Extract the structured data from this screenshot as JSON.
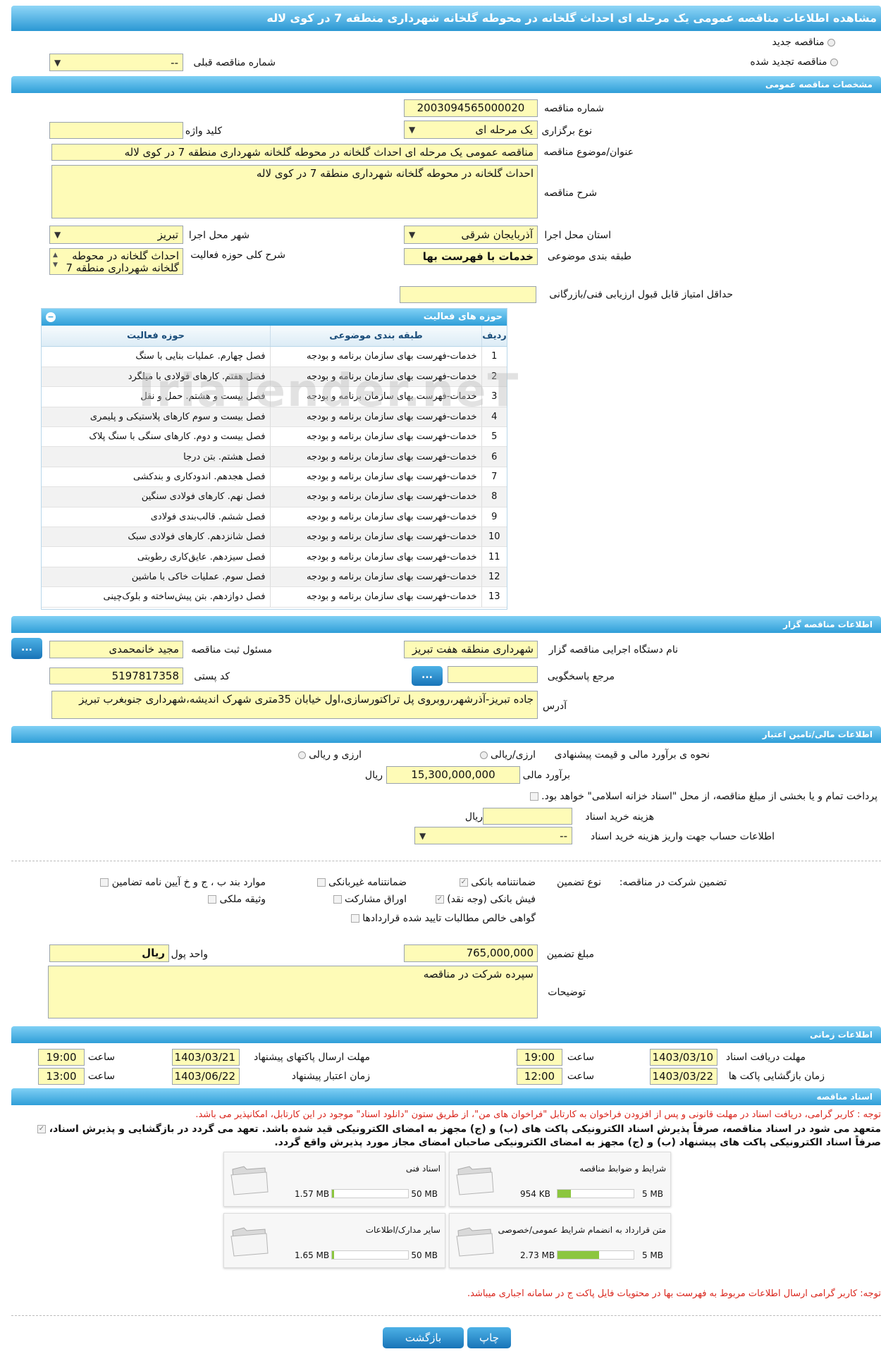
{
  "page_title": "مشاهده اطلاعات مناقصه عمومی یک مرحله ای احداث گلخانه در محوطه گلخانه شهرداری منطقه 7 در کوی لاله",
  "top": {
    "radio_new": "مناقصه جدید",
    "radio_renewed": "مناقصه تجدید شده",
    "prev_number_label": "شماره مناقصه قبلی",
    "prev_number_value": "--"
  },
  "general": {
    "section_title": "مشخصات مناقصه عمومی",
    "number_label": "شماره مناقصه",
    "number_value": "2003094565000020",
    "type_label": "نوع برگزاری",
    "type_value": "یک مرحله ای",
    "keyword_label": "کلید واژه",
    "keyword_value": "",
    "subject_label": "عنوان/موضوع مناقصه",
    "subject_value": "مناقصه عمومی یک مرحله ای احداث گلخانه در محوطه گلخانه شهرداری منطقه 7 در کوی لاله",
    "desc_label": "شرح مناقصه",
    "desc_value": "احداث گلخانه در محوطه گلخانه شهرداری منطقه 7 در کوی لاله",
    "province_label": "استان محل اجرا",
    "province_value": "آذربایجان شرقی",
    "city_label": "شهر محل اجرا",
    "city_value": "تبریز",
    "category_label": "طبقه بندی موضوعی",
    "category_value": "خدمات با فهرست بها",
    "activity_desc_label": "شرح کلی حوزه فعالیت",
    "activity_desc_value": "احداث گلخانه در محوطه گلخانه شهرداری منطقه 7",
    "min_score_label": "حداقل امتیاز قابل قبول ارزیابی فنی/بازرگانی",
    "min_score_value": ""
  },
  "activities": {
    "title": "حوزه های فعالیت",
    "col_row": "ردیف",
    "col_category": "طبقه بندی موضوعی",
    "col_activity": "حوزه فعالیت",
    "rows": [
      {
        "n": "1",
        "cat": "خدمات-فهرست بهای سازمان برنامه و بودجه",
        "act": "فصل چهارم. عملیات بنایی با سنگ"
      },
      {
        "n": "2",
        "cat": "خدمات-فهرست بهای سازمان برنامه و بودجه",
        "act": "فصل هفتم. کارهای فولادی با میلگرد"
      },
      {
        "n": "3",
        "cat": "خدمات-فهرست بهای سازمان برنامه و بودجه",
        "act": "فصل بیست و هشتم. حمل و نقل"
      },
      {
        "n": "4",
        "cat": "خدمات-فهرست بهای سازمان برنامه و بودجه",
        "act": "فصل بیست و سوم کارهای پلاستیکی و پلیمری"
      },
      {
        "n": "5",
        "cat": "خدمات-فهرست بهای سازمان برنامه و بودجه",
        "act": "فصل بیست و دوم. کارهای سنگی با سنگ پلاک"
      },
      {
        "n": "6",
        "cat": "خدمات-فهرست بهای سازمان برنامه و بودجه",
        "act": "فصل هشتم. بتن درجا"
      },
      {
        "n": "7",
        "cat": "خدمات-فهرست بهای سازمان برنامه و بودجه",
        "act": "فصل هجدهم. اندودکاری و بندکشی"
      },
      {
        "n": "8",
        "cat": "خدمات-فهرست بهای سازمان برنامه و بودجه",
        "act": "فصل نهم. کارهای فولادی سنگین"
      },
      {
        "n": "9",
        "cat": "خدمات-فهرست بهای سازمان برنامه و بودجه",
        "act": "فصل ششم. قالب‌بندی فولادی"
      },
      {
        "n": "10",
        "cat": "خدمات-فهرست بهای سازمان برنامه و بودجه",
        "act": "فصل شانزدهم. کارهای فولادی سبک"
      },
      {
        "n": "11",
        "cat": "خدمات-فهرست بهای سازمان برنامه و بودجه",
        "act": "فصل سیزدهم. عایق‌کاری رطوبتی"
      },
      {
        "n": "12",
        "cat": "خدمات-فهرست بهای سازمان برنامه و بودجه",
        "act": "فصل سوم. عملیات خاکی با ماشین"
      },
      {
        "n": "13",
        "cat": "خدمات-فهرست بهای سازمان برنامه و بودجه",
        "act": "فصل دوازدهم. بتن پیش‌ساخته و بلوک‌چینی"
      }
    ]
  },
  "organizer": {
    "section_title": "اطلاعات مناقصه گزار",
    "org_label": "نام دستگاه اجرایی مناقصه گزار",
    "org_value": "شهرداری منطقه هفت تبریز",
    "resp_label": "مسئول ثبت مناقصه",
    "resp_value": "مجید خانمحمدی",
    "ref_label": "مرجع پاسخگویی",
    "ref_value": "",
    "postal_label": "کد پستی",
    "postal_value": "5197817358",
    "address_label": "آدرس",
    "address_value": "جاده تبریز-آذرشهر،روبروی پل تراکتورسازی،اول خیابان 35متری شهرک اندیشه،شهرداری جنوبغرب تبریز",
    "dots": "..."
  },
  "finance": {
    "section_title": "اطلاعات مالی/تامین اعتبار",
    "method_label": "نحوه ی برآورد مالی و قیمت پیشنهادی",
    "opt1": "ارزی/ریالی",
    "opt2": "ارزی و ریالی",
    "estimate_label": "برآورد مالی",
    "estimate_value": "15,300,000,000",
    "rial": "ریال",
    "treasury_text": "پرداخت تمام و یا بخشی از مبلغ مناقصه، از محل \"اسناد خزانه اسلامی\" خواهد بود.",
    "doc_cost_label": "هزینه خرید اسناد",
    "doc_cost_value": "",
    "account_label": "اطلاعات حساب جهت واریز هزینه خرید اسناد",
    "account_value": "--"
  },
  "guarantee": {
    "label": "تضمین شرکت در مناقصه:",
    "type_label": "نوع تضمین",
    "opt_bank": "ضمانتنامه بانکی",
    "opt_nonbank": "ضمانتنامه غیربانکی",
    "opt_b": "موارد بند ب ، ج و خ آیین نامه تضامین",
    "opt_cash": "فیش بانکی (وجه نقد)",
    "opt_bonds": "اوراق مشارکت",
    "opt_property": "وثیقه ملکی",
    "opt_cert": "گواهی خالص مطالبات تایید شده قراردادها",
    "amount_label": "مبلغ تضمین",
    "amount_value": "765,000,000",
    "unit_label": "واحد پول",
    "unit_value": "ریال",
    "notes_label": "توضیحات",
    "notes_value": "سپرده شرکت در مناقصه"
  },
  "timing": {
    "section_title": "اطلاعات زمانی",
    "doc_receive_label": "مهلت دریافت اسناد",
    "doc_receive_date": "1403/03/10",
    "doc_receive_time": "19:00",
    "send_label": "مهلت ارسال پاکتهای پیشنهاد",
    "send_date": "1403/03/21",
    "send_time": "19:00",
    "open_label": "زمان بازگشایی پاکت ها",
    "open_date": "1403/03/22",
    "open_time": "12:00",
    "valid_label": "زمان اعتبار پیشنهاد",
    "valid_date": "1403/06/22",
    "valid_time": "13:00",
    "time_label": "ساعت"
  },
  "documents": {
    "section_title": "اسناد مناقصه",
    "note1": "توجه : کاربر گرامی، دریافت اسناد در مهلت قانونی و پس از افزودن فراخوان به کارتابل \"فراخوان های من\"، از طریق ستون \"دانلود اسناد\" موجود در این کارتابل، امکانپذیر می باشد.",
    "commit_line1": "متعهد می شود در اسناد مناقصه، صرفاً پذیرش اسناد الکترونیکی پاکت های (ب) و (ج) مجهز به امضای الکترونیکی قید شده باشد. تعهد می گردد در بازگشایی و پذیرش اسناد،",
    "commit_line2": "صرفاً اسناد الکترونیکی پاکت های پیشنهاد (ب) و (ج) مجهز به امضای الکترونیکی صاحبان امضای مجاز مورد پذیرش واقع گردد.",
    "files": [
      {
        "title": "شرایط و ضوابط مناقصه",
        "size": "954 KB",
        "max": "5 MB",
        "pct": 0.18
      },
      {
        "title": "اسناد فنی",
        "size": "1.57 MB",
        "max": "50 MB",
        "pct": 0.03
      },
      {
        "title": "متن قرارداد به انضمام شرایط عمومی/خصوصی",
        "size": "2.73 MB",
        "max": "5 MB",
        "pct": 0.55
      },
      {
        "title": "سایر مدارک/اطلاعات",
        "size": "1.65 MB",
        "max": "50 MB",
        "pct": 0.03
      }
    ],
    "note2": "توجه: کاربر گرامی ارسال اطلاعات مربوط به فهرست بها در محتویات فایل پاکت ج در سامانه اجباری میباشد."
  },
  "buttons": {
    "print": "چاپ",
    "back": "بازگشت"
  },
  "watermark": "IriaTender.neT"
}
